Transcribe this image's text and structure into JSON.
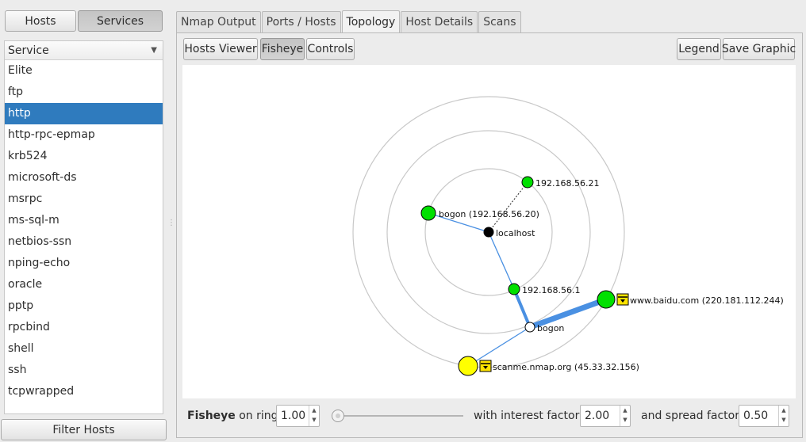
{
  "left_panel": {
    "hosts_label": "Hosts",
    "services_label": "Services",
    "column_header": "Service",
    "services": [
      "Elite",
      "ftp",
      "http",
      "http-rpc-epmap",
      "krb524",
      "microsoft-ds",
      "msrpc",
      "ms-sql-m",
      "netbios-ssn",
      "nping-echo",
      "oracle",
      "pptp",
      "rpcbind",
      "shell",
      "ssh",
      "tcpwrapped"
    ],
    "selected_service": "http",
    "filter_label": "Filter Hosts"
  },
  "tabs": [
    "Nmap Output",
    "Ports / Hosts",
    "Topology",
    "Host Details",
    "Scans"
  ],
  "active_tab": "Topology",
  "toolbar": {
    "hosts_viewer": "Hosts Viewer",
    "fisheye": "Fisheye",
    "controls": "Controls",
    "legend": "Legend",
    "save_graphic": "Save Graphic"
  },
  "topology": {
    "nodes": [
      {
        "id": "localhost",
        "label": "localhost",
        "color": "#000000"
      },
      {
        "id": "n21",
        "label": "192.168.56.21",
        "color": "#00e000"
      },
      {
        "id": "n20",
        "label": "bogon (192.168.56.20)",
        "color": "#00e000"
      },
      {
        "id": "n1",
        "label": "192.168.56.1",
        "color": "#00e000"
      },
      {
        "id": "bogon",
        "label": "bogon",
        "color": "#ffffff"
      },
      {
        "id": "baidu",
        "label": "www.baidu.com (220.181.112.244)",
        "color": "#00e000"
      },
      {
        "id": "scanme",
        "label": "scanme.nmap.org (45.33.32.156)",
        "color": "#ffff00"
      }
    ],
    "edges": [
      {
        "from": "localhost",
        "to": "n21",
        "style": "dashed"
      },
      {
        "from": "localhost",
        "to": "n20",
        "style": "solid"
      },
      {
        "from": "localhost",
        "to": "n1",
        "style": "solid"
      },
      {
        "from": "n1",
        "to": "bogon",
        "style": "solid"
      },
      {
        "from": "bogon",
        "to": "baidu",
        "style": "solid"
      },
      {
        "from": "bogon",
        "to": "scanme",
        "style": "solid"
      }
    ],
    "edge_color": "#4a90e2",
    "ring_color": "#c8c8c8"
  },
  "fisheye_controls": {
    "prefix": "Fisheye",
    "on_ring_label": "on ring",
    "ring_value": "1.00",
    "interest_label": "with interest factor",
    "interest_value": "2.00",
    "spread_label": "and spread factor",
    "spread_value": "0.50"
  }
}
